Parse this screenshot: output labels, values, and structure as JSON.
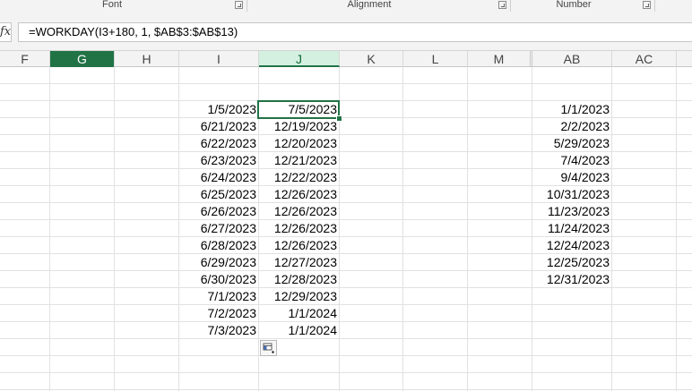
{
  "ribbon": {
    "groups": [
      {
        "label": "Font"
      },
      {
        "label": "Alignment"
      },
      {
        "label": "Number"
      }
    ]
  },
  "formula_bar": {
    "fx_label": "fx",
    "formula": "=WORKDAY(I3+180, 1, $AB$3:$AB$13)"
  },
  "columns": [
    "F",
    "G",
    "H",
    "I",
    "J",
    "K",
    "L",
    "M",
    "AB",
    "AC"
  ],
  "selected_column": "J",
  "active_column": "G",
  "col_I": [
    "1/5/2023",
    "6/21/2023",
    "6/22/2023",
    "6/23/2023",
    "6/24/2023",
    "6/25/2023",
    "6/26/2023",
    "6/27/2023",
    "6/28/2023",
    "6/29/2023",
    "6/30/2023",
    "7/1/2023",
    "7/2/2023",
    "7/3/2023"
  ],
  "col_J": [
    "7/5/2023",
    "12/19/2023",
    "12/20/2023",
    "12/21/2023",
    "12/22/2023",
    "12/26/2023",
    "12/26/2023",
    "12/26/2023",
    "12/26/2023",
    "12/27/2023",
    "12/28/2023",
    "12/29/2023",
    "1/1/2024",
    "1/1/2024"
  ],
  "col_AB": [
    "1/1/2023",
    "2/2/2023",
    "5/29/2023",
    "7/4/2023",
    "9/4/2023",
    "10/31/2023",
    "11/23/2023",
    "11/24/2023",
    "12/24/2023",
    "12/25/2023",
    "12/31/2023"
  ],
  "colors": {
    "accent": "#217346",
    "grid": "#e1e1e1",
    "header_bg": "#f3f3f3"
  },
  "icons": {
    "quick_analysis": "quick-analysis-icon",
    "dialog_launcher": "dialog-launcher-icon"
  }
}
